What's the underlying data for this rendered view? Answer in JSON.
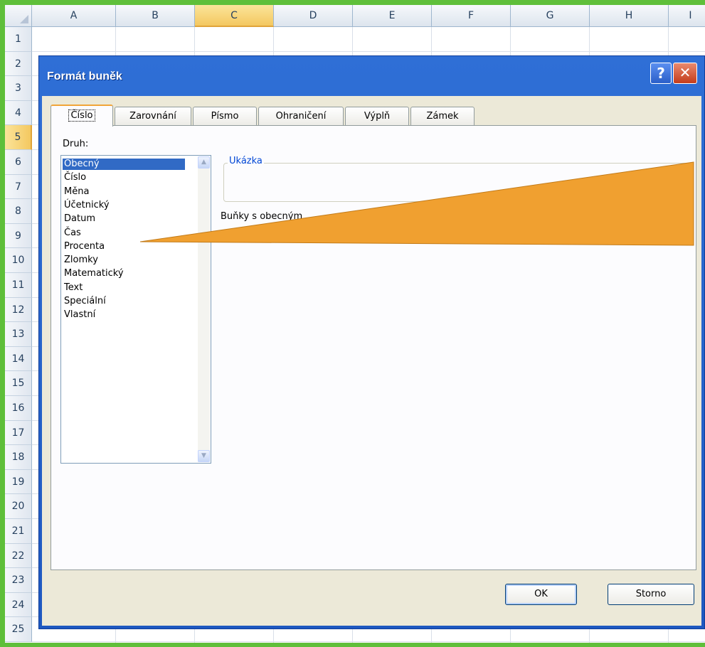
{
  "spreadsheet": {
    "columns": [
      "A",
      "B",
      "C",
      "D",
      "E",
      "F",
      "G",
      "H",
      "I"
    ],
    "selected_column": "C",
    "rows": [
      "1",
      "2",
      "3",
      "4",
      "5",
      "6",
      "7",
      "8",
      "9",
      "10",
      "11",
      "12",
      "13",
      "14",
      "15",
      "16",
      "17",
      "18",
      "19",
      "20",
      "21",
      "22",
      "23",
      "24",
      "25"
    ],
    "selected_row": "5"
  },
  "dialog": {
    "title": "Formát buněk",
    "help_glyph": "?",
    "close_glyph": "✕",
    "tabs": [
      {
        "label": "Číslo",
        "active": true
      },
      {
        "label": "Zarovnání"
      },
      {
        "label": "Písmo"
      },
      {
        "label": "Ohraničení"
      },
      {
        "label": "Výplň"
      },
      {
        "label": "Zámek"
      }
    ],
    "category_label": "Druh:",
    "categories": [
      "Obecný",
      "Číslo",
      "Měna",
      "Účetnický",
      "Datum",
      "Čas",
      "Procenta",
      "Zlomky",
      "Matematický",
      "Text",
      "Speciální",
      "Vlastní"
    ],
    "selected_category": "Obecný",
    "sample_legend": "Ukázka",
    "description": "Buňky s obecným",
    "ok_label": "OK",
    "cancel_label": "Storno"
  },
  "colors": {
    "frame": "#5fbf3a",
    "titlebar": "#2f6fd6",
    "selection": "#316ac5",
    "callout": "#f0a030"
  },
  "icons": {
    "help": "question-mark-icon",
    "close": "close-icon",
    "scroll_up": "chevron-up-icon",
    "scroll_down": "chevron-down-icon"
  }
}
